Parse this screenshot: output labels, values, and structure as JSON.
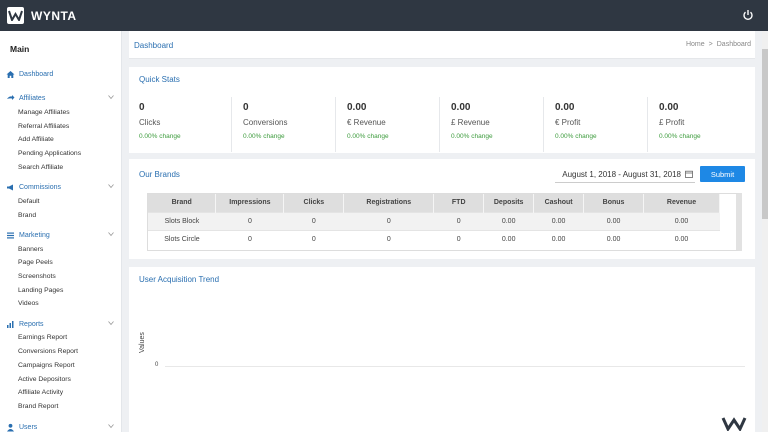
{
  "header": {
    "app_name": "WYNTA",
    "logo_icon": "wynta-logo-icon",
    "power_icon": "power-icon"
  },
  "sidebar": {
    "main_label": "Main",
    "dashboard": "Dashboard",
    "sections": [
      {
        "label": "Affiliates",
        "items": [
          "Manage Affiliates",
          "Referral Affiliates",
          "Add Affiliate",
          "Pending Applications",
          "Search Affiliate"
        ]
      },
      {
        "label": "Commissions",
        "items": [
          "Default",
          "Brand"
        ]
      },
      {
        "label": "Marketing",
        "items": [
          "Banners",
          "Page Peels",
          "Screenshots",
          "Landing Pages",
          "Videos"
        ]
      },
      {
        "label": "Reports",
        "items": [
          "Earnings Report",
          "Conversions Report",
          "Campaigns Report",
          "Active Depositors",
          "Affiliate Activity",
          "Brand Report"
        ]
      },
      {
        "label": "Users",
        "items": []
      }
    ]
  },
  "breadcrumb": {
    "title": "Dashboard",
    "home": "Home",
    "separator": ">",
    "current": "Dashboard"
  },
  "quick_stats": {
    "title": "Quick Stats",
    "items": [
      {
        "value": "0",
        "label": "Clicks",
        "change": "0.00% change"
      },
      {
        "value": "0",
        "label": "Conversions",
        "change": "0.00% change"
      },
      {
        "value": "0.00",
        "label": "€ Revenue",
        "change": "0.00% change"
      },
      {
        "value": "0.00",
        "label": "£ Revenue",
        "change": "0.00% change"
      },
      {
        "value": "0.00",
        "label": "€ Profit",
        "change": "0.00% change"
      },
      {
        "value": "0.00",
        "label": "£ Profit",
        "change": "0.00% change"
      }
    ]
  },
  "brands": {
    "title": "Our Brands",
    "date_range": "August 1, 2018 - August 31, 2018",
    "submit_label": "Submit",
    "columns": [
      "Brand",
      "Impressions",
      "Clicks",
      "Registrations",
      "FTD",
      "Deposits",
      "Cashout",
      "Bonus",
      "Revenue"
    ],
    "rows": [
      [
        "Slots Block",
        "0",
        "0",
        "0",
        "0",
        "0.00",
        "0.00",
        "0.00",
        "0.00"
      ],
      [
        "Slots Circle",
        "0",
        "0",
        "0",
        "0",
        "0.00",
        "0.00",
        "0.00",
        "0.00"
      ]
    ]
  },
  "trend": {
    "title": "User Acquisition Trend",
    "y_label": "Values",
    "y_tick": "0"
  },
  "colors": {
    "accent": "#2a6fb0",
    "topbar": "#2f3742",
    "submit": "#1e88e5",
    "positive": "#3c9b3c"
  }
}
